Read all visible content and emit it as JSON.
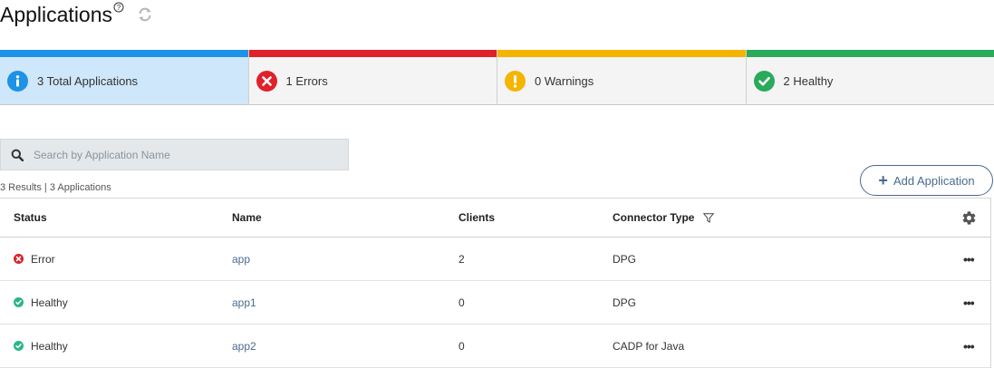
{
  "page": {
    "title": "Applications",
    "help_mark": "?"
  },
  "summary": [
    {
      "label": "3 Total Applications",
      "color": "#1d92e6",
      "icon": "info-icon"
    },
    {
      "label": "1 Errors",
      "color": "#e0202b",
      "icon": "error-icon"
    },
    {
      "label": "0 Warnings",
      "color": "#f5b400",
      "icon": "warning-icon"
    },
    {
      "label": "2 Healthy",
      "color": "#2aaa5a",
      "icon": "check-icon"
    }
  ],
  "search": {
    "placeholder": "Search by Application Name"
  },
  "results_text": "3 Results | 3 Applications",
  "add_button": {
    "plus": "+",
    "label": "Add Application"
  },
  "table": {
    "columns": [
      "Status",
      "Name",
      "Clients",
      "Connector Type"
    ],
    "rows": [
      {
        "status": "Error",
        "status_color": "#d8232a",
        "name": "app",
        "clients": "2",
        "connector": "DPG"
      },
      {
        "status": "Healthy",
        "status_color": "#2bb58a",
        "name": "app1",
        "clients": "0",
        "connector": "DPG"
      },
      {
        "status": "Healthy",
        "status_color": "#2bb58a",
        "name": "app2",
        "clients": "0",
        "connector": "CADP for Java"
      }
    ],
    "more_label": "•••"
  }
}
